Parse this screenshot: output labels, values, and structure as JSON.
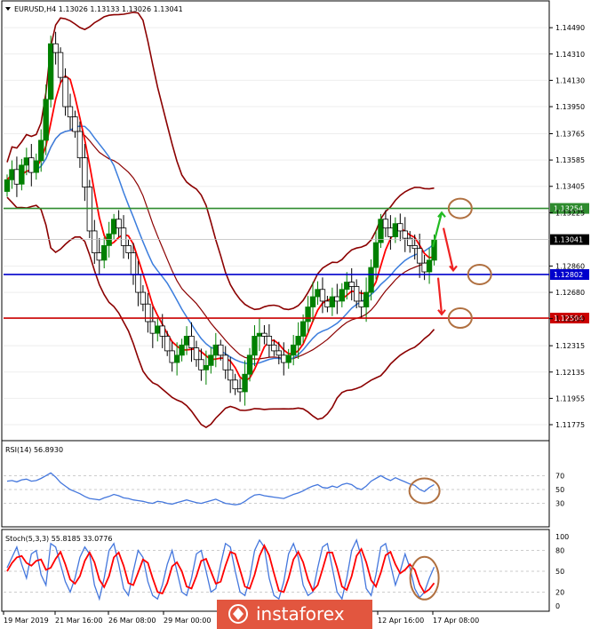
{
  "header": {
    "symbol_line": "EURUSD,H4  1.13026 1.13133 1.13026 1.13041"
  },
  "watermark": {
    "text": "instaforex",
    "logo_icon": "instaforex-logo-icon",
    "color": "#e2563f"
  },
  "colors": {
    "bull": "#008000",
    "bear": "#000000",
    "ema_fast": "#ff0000",
    "sma_slow": "#3b7ddd",
    "bands": "#8b0000",
    "resistance": "#2e8b2e",
    "pivot": "#0000cc",
    "support": "#cc0000",
    "rsi": "#4477dd",
    "stoch_main": "#4477dd",
    "stoch_signal": "#ff0000",
    "circle": "#b07040",
    "arrow_up": "#22bb22",
    "arrow_down": "#ee2222"
  },
  "chart_data": [
    {
      "type": "candlestick",
      "title": "EURUSD,H4  1.13026 1.13133 1.13026 1.13041",
      "ylim": [
        1.1169,
        1.1457
      ],
      "y_ticks": [
        "1.14490",
        "1.14310",
        "1.14130",
        "1.13950",
        "1.13765",
        "1.13585",
        "1.13405",
        "1.13225",
        "1.12860",
        "1.12680",
        "1.12500",
        "1.12315",
        "1.12135",
        "1.11955",
        "1.11775"
      ],
      "x_ticks": [
        "19 Mar 2019",
        "21 Mar 16:00",
        "26 Mar 08:00",
        "29 Mar 00:00",
        "12 Apr 16:00",
        "17 Apr 08:00"
      ],
      "levels": [
        {
          "name": "resistance",
          "value": 1.13254,
          "label": "1.13254"
        },
        {
          "name": "pivot",
          "value": 1.12802,
          "label": "1.12802"
        },
        {
          "name": "support",
          "value": 1.12504,
          "label": "1.12504"
        }
      ],
      "current_price": {
        "value": 1.13041,
        "label": "1.13041"
      },
      "close": [
        1.1345,
        1.1352,
        1.1342,
        1.1355,
        1.136,
        1.135,
        1.1358,
        1.1372,
        1.14,
        1.1438,
        1.1432,
        1.1415,
        1.1395,
        1.1388,
        1.1378,
        1.136,
        1.134,
        1.131,
        1.1295,
        1.129,
        1.13,
        1.1308,
        1.1318,
        1.1312,
        1.13,
        1.1295,
        1.128,
        1.1268,
        1.126,
        1.1248,
        1.124,
        1.1245,
        1.1238,
        1.1228,
        1.122,
        1.1225,
        1.1232,
        1.1238,
        1.123,
        1.1222,
        1.1215,
        1.1218,
        1.1225,
        1.1232,
        1.1225,
        1.1215,
        1.1208,
        1.1202,
        1.12,
        1.1212,
        1.1225,
        1.1238,
        1.124,
        1.1238,
        1.1232,
        1.1228,
        1.1225,
        1.122,
        1.1225,
        1.1232,
        1.1238,
        1.1248,
        1.1258,
        1.1265,
        1.127,
        1.1262,
        1.1258,
        1.1265,
        1.1262,
        1.127,
        1.1275,
        1.1272,
        1.1262,
        1.1258,
        1.1268,
        1.1285,
        1.1302,
        1.1318,
        1.1312,
        1.1306,
        1.1315,
        1.131,
        1.1305,
        1.13,
        1.1298,
        1.1288,
        1.1282,
        1.129,
        1.1304
      ],
      "bands_period": 20,
      "ma_fast_period": 5,
      "ma_slow_period": 14,
      "annotations": [
        {
          "shape": "circle",
          "value": 1.13254,
          "bar": 93
        },
        {
          "shape": "circle",
          "value": 1.12802,
          "bar": 97
        },
        {
          "shape": "circle",
          "value": 1.12504,
          "bar": 93
        },
        {
          "shape": "arrow",
          "direction": "up",
          "from": 1.1299,
          "to": 1.13225
        },
        {
          "shape": "arrow",
          "direction": "down",
          "from": 1.1312,
          "to": 1.1283
        },
        {
          "shape": "arrow",
          "direction": "down",
          "from": 1.1278,
          "to": 1.1253
        }
      ]
    },
    {
      "type": "line",
      "title": "RSI(14) 56.8930",
      "ylim": [
        0,
        100
      ],
      "y_ticks": [
        "70",
        "50",
        "30"
      ],
      "series": [
        {
          "name": "RSI(14)",
          "values": [
            62,
            63,
            61,
            64,
            65,
            62,
            63,
            66,
            70,
            74,
            68,
            60,
            55,
            50,
            47,
            44,
            40,
            37,
            36,
            35,
            38,
            40,
            43,
            41,
            38,
            37,
            35,
            34,
            33,
            31,
            30,
            33,
            32,
            30,
            29,
            31,
            33,
            35,
            33,
            31,
            30,
            32,
            34,
            36,
            33,
            30,
            29,
            28,
            29,
            33,
            38,
            42,
            43,
            41,
            40,
            39,
            38,
            37,
            40,
            43,
            45,
            48,
            52,
            55,
            57,
            53,
            52,
            55,
            53,
            57,
            59,
            57,
            52,
            50,
            55,
            62,
            66,
            70,
            66,
            63,
            67,
            64,
            61,
            58,
            56,
            50,
            47,
            53,
            57
          ]
        }
      ]
    },
    {
      "type": "line",
      "title": "Stoch(5,3,3) 55.8185 33.0776",
      "ylim": [
        0,
        100
      ],
      "y_ticks": [
        "100",
        "80",
        "50",
        "20",
        "0"
      ],
      "series": [
        {
          "name": "%K",
          "values": [
            55,
            70,
            85,
            60,
            40,
            75,
            80,
            45,
            30,
            90,
            85,
            60,
            35,
            20,
            40,
            70,
            85,
            75,
            30,
            10,
            40,
            80,
            90,
            60,
            25,
            15,
            50,
            80,
            70,
            35,
            15,
            10,
            30,
            60,
            80,
            50,
            20,
            15,
            40,
            75,
            80,
            50,
            20,
            25,
            60,
            90,
            85,
            50,
            20,
            15,
            40,
            80,
            95,
            85,
            40,
            15,
            10,
            35,
            75,
            90,
            70,
            30,
            15,
            20,
            55,
            85,
            90,
            55,
            20,
            10,
            40,
            80,
            95,
            70,
            25,
            15,
            45,
            85,
            90,
            60,
            30,
            50,
            75,
            55,
            25,
            12,
            20,
            40,
            56
          ]
        },
        {
          "name": "%D",
          "values": [
            50,
            62,
            70,
            72,
            62,
            58,
            65,
            67,
            52,
            55,
            68,
            78,
            60,
            38,
            32,
            43,
            65,
            77,
            63,
            38,
            27,
            43,
            70,
            77,
            58,
            33,
            30,
            48,
            67,
            62,
            40,
            20,
            18,
            33,
            57,
            63,
            50,
            28,
            25,
            43,
            65,
            68,
            50,
            32,
            35,
            58,
            78,
            75,
            52,
            28,
            25,
            45,
            72,
            87,
            73,
            47,
            22,
            20,
            40,
            67,
            78,
            63,
            38,
            22,
            30,
            53,
            77,
            77,
            55,
            28,
            23,
            43,
            72,
            82,
            63,
            37,
            28,
            48,
            73,
            78,
            60,
            47,
            52,
            60,
            52,
            31,
            19,
            24,
            33
          ]
        }
      ]
    }
  ]
}
